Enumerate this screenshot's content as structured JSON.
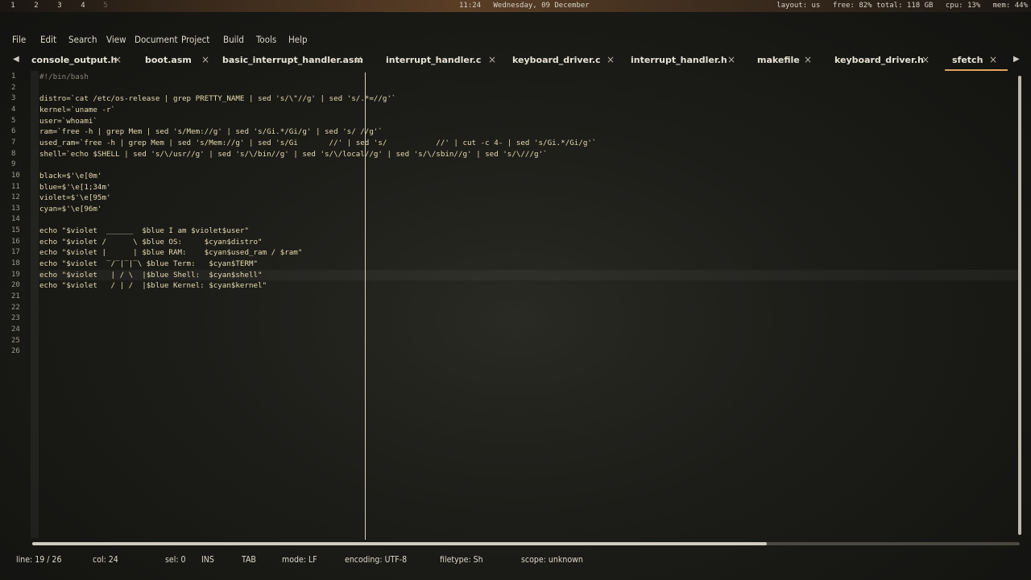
{
  "topbar": {
    "workspaces": [
      "1",
      "2",
      "3",
      "4",
      "5"
    ],
    "time": "11:24",
    "date": "Wednesday, 09 December",
    "layout": "layout: us",
    "disk": "free: 82% total: 118 GB",
    "cpu": "cpu: 13%",
    "mem": "mem: 44%"
  },
  "menu": [
    "File",
    "Edit",
    "Search",
    "View",
    "Document",
    "Project",
    "Build",
    "Tools",
    "Help"
  ],
  "tabs": [
    {
      "label": "console_output.h"
    },
    {
      "label": "boot.asm"
    },
    {
      "label": "basic_interrupt_handler.asm"
    },
    {
      "label": "interrupt_handler.c"
    },
    {
      "label": "keyboard_driver.c"
    },
    {
      "label": "interrupt_handler.h"
    },
    {
      "label": "makefile"
    },
    {
      "label": "keyboard_driver.h"
    },
    {
      "label": "sfetch"
    }
  ],
  "tab_close": "×",
  "arrows": {
    "left": "◀",
    "right": "▶"
  },
  "editor": {
    "lines": [
      "#!/bin/bash",
      "",
      "distro=`cat /etc/os-release | grep PRETTY_NAME | sed 's/\\\"//g' | sed 's/.*=//g'`",
      "kernel=`uname -r`",
      "user=`whoami`",
      "ram=`free -h | grep Mem | sed 's/Mem://g' | sed 's/Gi.*/Gi/g' | sed 's/ //g'`",
      "used_ram=`free -h | grep Mem | sed 's/Mem://g' | sed 's/Gi       //' | sed 's/           //' | cut -c 4- | sed 's/Gi.*/Gi/g'`",
      "shell=`echo $SHELL | sed 's/\\/usr//g' | sed 's/\\/bin//g' | sed 's/\\/local//g' | sed 's/\\/sbin//g' | sed 's/\\///g'`",
      "",
      "black=$'\\e[0m'",
      "blue=$'\\e[1;34m'",
      "violet=$'\\e[95m'",
      "cyan=$'\\e[96m'",
      "",
      "echo \"$violet  ______  $blue I am $violet$user\"",
      "echo \"$violet /      \\ $blue OS:     $cyan$distro\"",
      "echo \"$violet |      | $blue RAM:    $cyan$used_ram / $ram\"",
      "echo \"$violet  ‾/‾|‾|‾\\ $blue Term:   $cyan$TERM\"",
      "echo \"$violet   | / \\  |$blue Shell:  $cyan$shell\"",
      "echo \"$violet   / | /  |$blue Kernel: $cyan$kernel\"",
      "",
      "",
      "",
      "",
      "",
      ""
    ]
  },
  "status": {
    "line": "line: 19 / 26",
    "col": "col: 24",
    "sel": "sel: 0",
    "mode_ins": "INS",
    "tab": "TAB",
    "eol": "mode: LF",
    "encoding": "encoding: UTF-8",
    "filetype": "filetype: Sh",
    "scope": "scope: unknown"
  }
}
